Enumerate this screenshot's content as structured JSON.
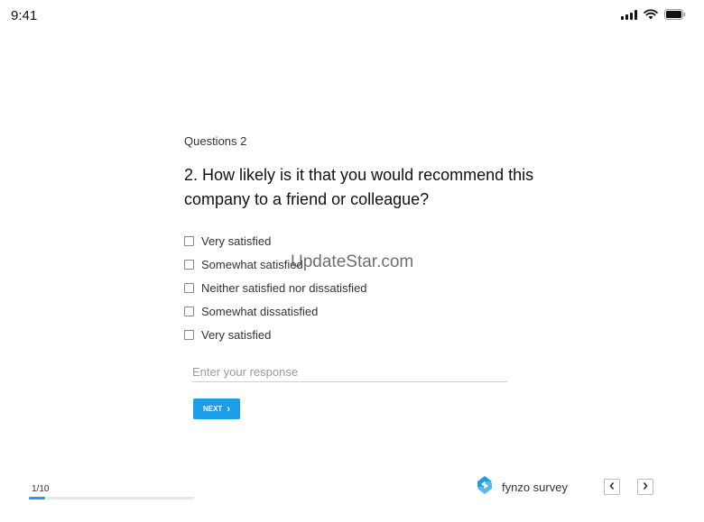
{
  "status_bar": {
    "time": "9:41"
  },
  "question": {
    "number_label": "Questions 2",
    "title": "2. How likely is it that you would recommend this company to a friend or colleague?",
    "options": [
      {
        "label": "Very satisfied",
        "checked": false
      },
      {
        "label": "Somewhat satisfied",
        "checked": false
      },
      {
        "label": "Neither satisfied nor dissatisfied",
        "checked": false
      },
      {
        "label": "Somewhat dissatisfied",
        "checked": false
      },
      {
        "label": "Very satisfied",
        "checked": false
      }
    ],
    "response_placeholder": "Enter your response",
    "response_value": "",
    "next_label": "NEXT"
  },
  "watermark": "UpdateStar.com",
  "footer": {
    "progress_label": "1/10",
    "progress_fraction": 0.1,
    "brand_name": "fynzo survey",
    "icons": {
      "prev": "chevron-left-icon",
      "next": "chevron-right-icon",
      "logo": "fynzo-logo-icon"
    }
  },
  "colors": {
    "accent": "#1b9de8",
    "progress_track": "#e7e7e7",
    "text": "#222222"
  }
}
